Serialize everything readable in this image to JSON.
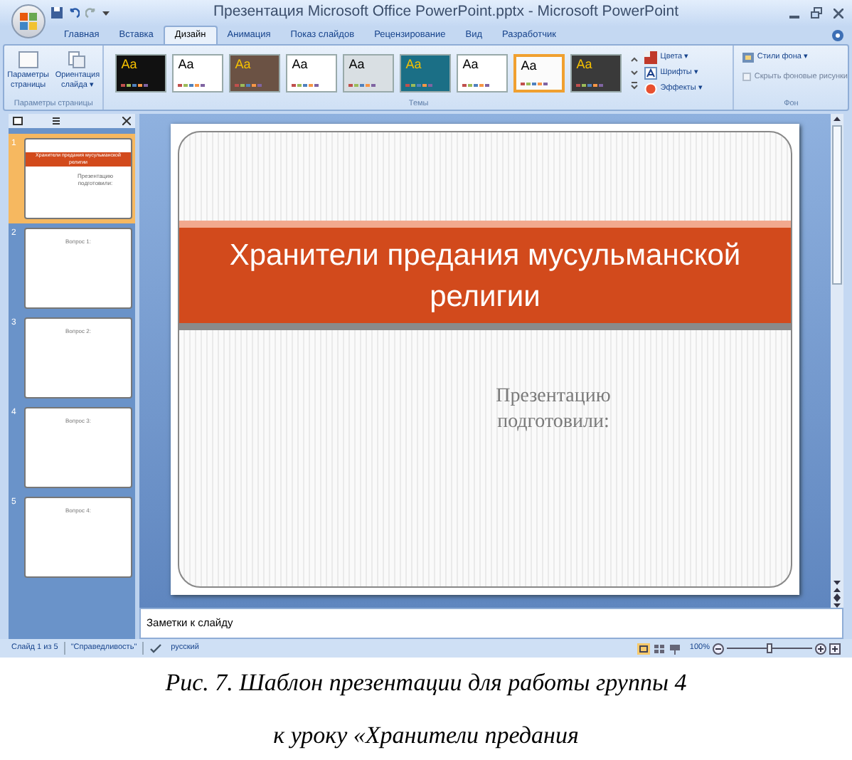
{
  "window": {
    "title": "Презентация Microsoft Office PowerPoint.pptx - Microsoft PowerPoint"
  },
  "tabs": [
    {
      "label": "Главная",
      "selected": false
    },
    {
      "label": "Вставка",
      "selected": false
    },
    {
      "label": "Дизайн",
      "selected": true
    },
    {
      "label": "Анимация",
      "selected": false
    },
    {
      "label": "Показ слайдов",
      "selected": false
    },
    {
      "label": "Рецензирование",
      "selected": false
    },
    {
      "label": "Вид",
      "selected": false
    },
    {
      "label": "Разработчик",
      "selected": false
    }
  ],
  "ribbon": {
    "page_setup": {
      "buttons": [
        {
          "line1": "Параметры",
          "line2": "страницы",
          "kind": "page"
        },
        {
          "line1": "Ориентация",
          "line2": "слайда ▾",
          "kind": "orient"
        }
      ],
      "label": "Параметры страницы"
    },
    "themes": {
      "label": "Темы",
      "items": [
        {
          "label": "Aa",
          "color": "#111111",
          "selected": false
        },
        {
          "label": "Aa",
          "color": "#ffffff",
          "selected": false
        },
        {
          "label": "Aa",
          "color": "#6b5244",
          "selected": false
        },
        {
          "label": "Aa",
          "color": "#ffffff",
          "selected": false
        },
        {
          "label": "Aa",
          "color": "#d9dfe3",
          "selected": false
        },
        {
          "label": "Aa",
          "color": "#1b6f86",
          "selected": false
        },
        {
          "label": "Aa",
          "color": "#ffffff",
          "selected": false
        },
        {
          "label": "Aa",
          "color": "#fbfbfb",
          "selected": true
        },
        {
          "label": "Aa",
          "color": "#3a3a3a",
          "selected": false
        }
      ],
      "options": [
        {
          "label": "Цвета ▾",
          "kind": "colors"
        },
        {
          "label": "Шрифты ▾",
          "kind": "fonts"
        },
        {
          "label": "Эффекты ▾",
          "kind": "effects"
        }
      ]
    },
    "background": {
      "label": "Фон",
      "styles": "Стили фона ▾",
      "hide": {
        "label": "Скрыть фоновые рисунки",
        "checked": false
      }
    }
  },
  "slides": [
    {
      "number": "1",
      "selected": true,
      "kind": "title",
      "title": "Хранители предания мусульманской религии",
      "subtitle": "Презентацию подготовили:"
    },
    {
      "number": "2",
      "selected": false,
      "kind": "question",
      "title": "Вопрос 1:"
    },
    {
      "number": "3",
      "selected": false,
      "kind": "question",
      "title": "Вопрос 2:"
    },
    {
      "number": "4",
      "selected": false,
      "kind": "question",
      "title": "Вопрос 3:"
    },
    {
      "number": "5",
      "selected": false,
      "kind": "question",
      "title": "Вопрос 4:"
    }
  ],
  "slide": {
    "title": "Хранители предания мусульманской религии",
    "subtitle": "Презентацию подготовили:"
  },
  "notes": {
    "placeholder": "Заметки к слайду"
  },
  "status_bar": {
    "slide": "Слайд 1 из 5",
    "theme": "\"Справедливость\"",
    "language": "русский",
    "zoom": "100%",
    "zoom_level": {
      "level": 0.5
    }
  },
  "caption": {
    "line1": "Рис. 7. Шаблон презентации для работы группы 4",
    "line2": "к уроку «Хранители предания"
  }
}
